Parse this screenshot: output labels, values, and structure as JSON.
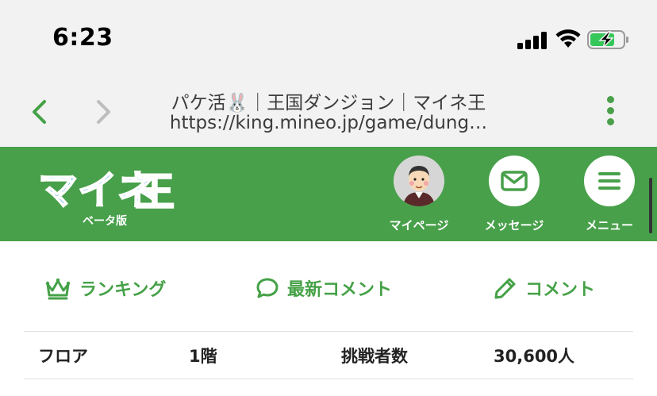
{
  "status": {
    "time": "6:23"
  },
  "browser": {
    "page_title": "パケ活🐰｜王国ダンジョン｜マイネ王",
    "url": "https://king.mineo.jp/game/dung…"
  },
  "header": {
    "logo_text": "マイネ王",
    "beta_label": "ベータ版",
    "buttons": [
      {
        "label": "マイページ",
        "icon": "avatar-icon"
      },
      {
        "label": "メッセージ",
        "icon": "mail-icon"
      },
      {
        "label": "メニュー",
        "icon": "hamburger-icon"
      }
    ]
  },
  "actions": [
    {
      "label": "ランキング",
      "icon": "crown-icon"
    },
    {
      "label": "最新コメント",
      "icon": "speech-bubble-icon"
    },
    {
      "label": "コメント",
      "icon": "pencil-icon"
    }
  ],
  "info": {
    "floor_label": "フロア",
    "floor_value": "1階",
    "challengers_label": "挑戦者数",
    "challengers_value": "30,600人"
  },
  "colors": {
    "brand_green": "#48a04a",
    "icon_green": "#45a147"
  }
}
